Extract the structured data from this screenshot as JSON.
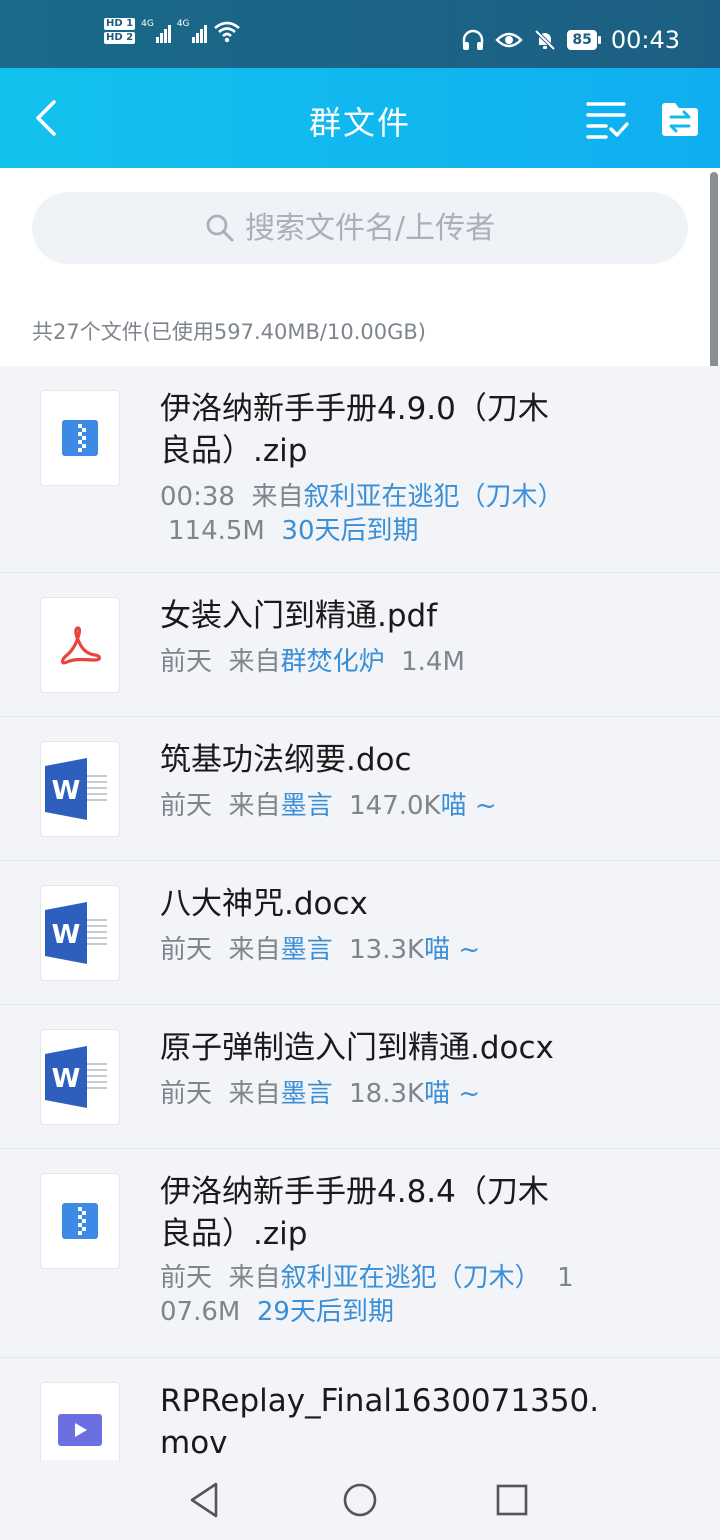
{
  "status_bar": {
    "sim1": "HD 1",
    "sim2": "HD 2",
    "net1": "4G",
    "net2": "4G",
    "battery": "85",
    "time": "00:43"
  },
  "header": {
    "title": "群文件"
  },
  "search": {
    "placeholder": "搜索文件名/上传者"
  },
  "summary": "共27个文件(已使用597.40MB/10.00GB)",
  "colors": {
    "header": "#12c2ee",
    "link": "#3a8fd6",
    "zip": "#3d8ae6",
    "pdf": "#e8453c",
    "word": "#2f5fbd",
    "video": "#6c6fe0"
  },
  "files": [
    {
      "icon": "zip-icon",
      "name_lines": [
        "伊洛纳新手手册4.9.0（刀木",
        "良品）.zip"
      ],
      "time": "00:38",
      "from": "来自",
      "uploader": "叙利亚在逃犯（刀木）",
      "size": "114.5M",
      "expire": "30天后到期"
    },
    {
      "icon": "pdf-icon",
      "name_lines": [
        "女装入门到精通.pdf"
      ],
      "time": "前天",
      "from": "来自",
      "uploader": "群焚化炉",
      "size": "1.4M"
    },
    {
      "icon": "word-icon",
      "name_lines": [
        "筑基功法纲要.doc"
      ],
      "time": "前天",
      "from": "来自",
      "uploader": "墨言",
      "size": "147.0K",
      "suffix": "喵 ~"
    },
    {
      "icon": "word-icon",
      "name_lines": [
        "八大神咒.docx"
      ],
      "time": "前天",
      "from": "来自",
      "uploader": "墨言",
      "size": "13.3K",
      "suffix": "喵 ~"
    },
    {
      "icon": "word-icon",
      "name_lines": [
        "原子弹制造入门到精通.docx"
      ],
      "time": "前天",
      "from": "来自",
      "uploader": "墨言",
      "size": "18.3K",
      "suffix": "喵 ~"
    },
    {
      "icon": "zip-icon",
      "name_lines": [
        "伊洛纳新手手册4.8.4（刀木",
        "良品）.zip"
      ],
      "time": "前天",
      "from": "来自",
      "uploader": "叙利亚在逃犯（刀木）",
      "size_lines": [
        "1",
        "07.6M"
      ],
      "expire": "29天后到期"
    },
    {
      "icon": "video-icon",
      "name_lines": [
        "RPReplay_Final1630071350.",
        "mov"
      ]
    }
  ]
}
